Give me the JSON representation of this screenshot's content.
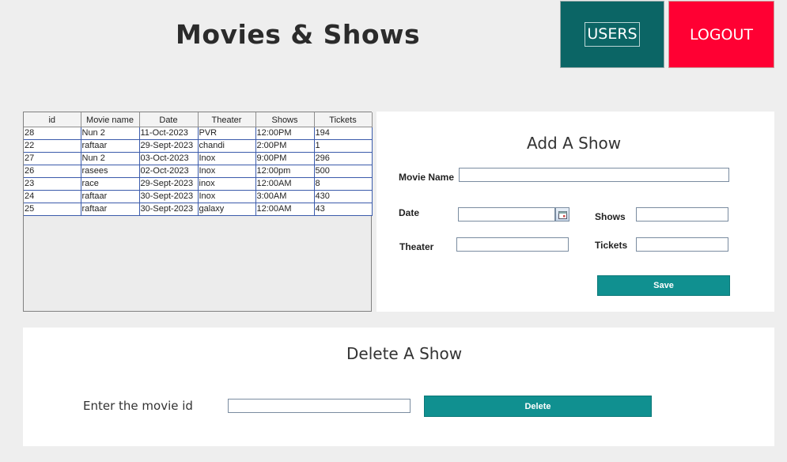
{
  "header": {
    "title": "Movies & Shows",
    "users_label": "USERS",
    "logout_label": "LOGOUT"
  },
  "colors": {
    "users_bg": "#0b6565",
    "logout_bg": "#ff0033",
    "action_bg": "#109090",
    "page_bg": "#eeeeee"
  },
  "table": {
    "columns": [
      "id",
      "Movie name",
      "Date",
      "Theater",
      "Shows",
      "Tickets"
    ],
    "rows": [
      [
        "28",
        "Nun 2",
        "11-Oct-2023",
        "PVR",
        "12:00PM",
        "194"
      ],
      [
        "22",
        "raftaar",
        "29-Sept-2023",
        "chandi",
        "2:00PM",
        "1"
      ],
      [
        "27",
        "Nun 2",
        "03-Oct-2023",
        "Inox",
        "9:00PM",
        "296"
      ],
      [
        "26",
        "rasees",
        "02-Oct-2023",
        "Inox",
        "12:00pm",
        "500"
      ],
      [
        "23",
        "race",
        "29-Sept-2023",
        "inox",
        "12:00AM",
        "8"
      ],
      [
        "24",
        "raftaar",
        "30-Sept-2023",
        "Inox",
        "3:00AM",
        "430"
      ],
      [
        "25",
        "raftaar",
        "30-Sept-2023",
        "galaxy",
        "12:00AM",
        "43"
      ]
    ]
  },
  "add_show": {
    "title": "Add A Show",
    "movie_name_label": "Movie Name",
    "movie_name_value": "",
    "date_label": "Date",
    "date_value": "",
    "shows_label": "Shows",
    "shows_value": "",
    "theater_label": "Theater",
    "theater_value": "",
    "tickets_label": "Tickets",
    "tickets_value": "",
    "save_label": "Save",
    "calendar_icon": "calendar-icon"
  },
  "delete_show": {
    "title": "Delete A Show",
    "id_label": "Enter the movie id",
    "id_value": "",
    "delete_label": "Delete"
  }
}
